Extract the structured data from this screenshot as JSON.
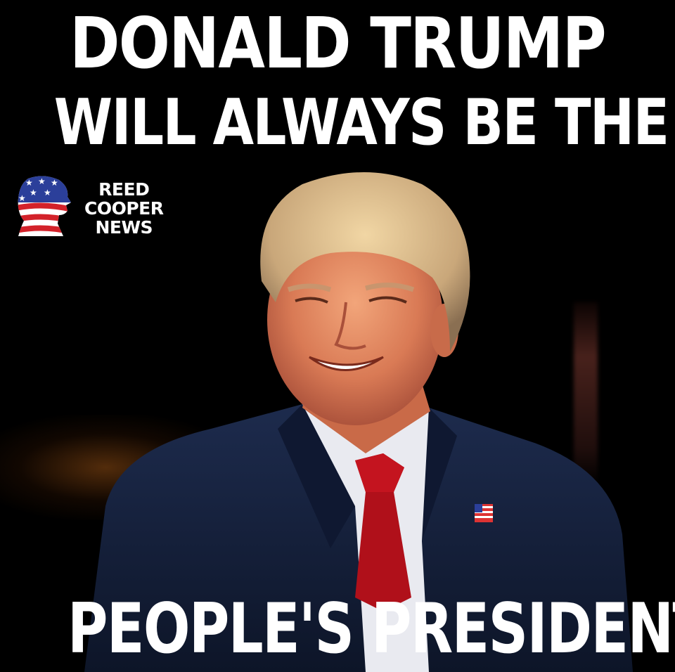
{
  "headline": {
    "line1": "DONALD TRUMP",
    "line2": "WILL ALWAYS BE THE",
    "line3": "PEOPLE'S PRESIDENT"
  },
  "logo": {
    "name_line1": "REED",
    "name_line2": "COOPER",
    "name_line3": "NEWS",
    "icon": "american-flag-head-silhouette-icon"
  },
  "colors": {
    "background": "#000000",
    "text": "#ffffff",
    "suit": "#15203a",
    "tie": "#b0101a",
    "flag_red": "#d3222a",
    "flag_blue": "#2b3f9a"
  }
}
